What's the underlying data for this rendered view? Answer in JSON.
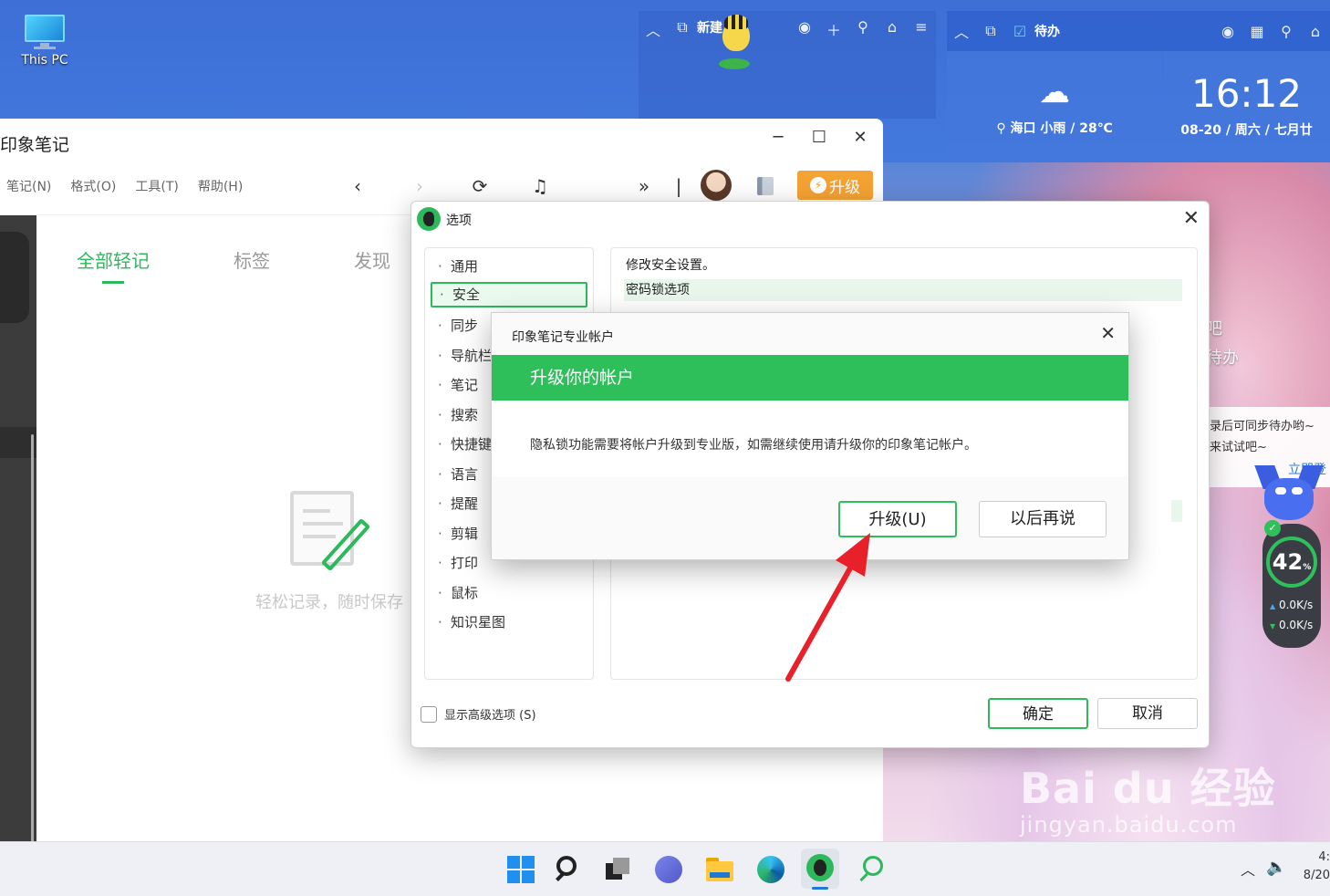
{
  "desktop": {
    "icon_label": "This PC",
    "watermark_brand": "Bai du 经验",
    "watermark_url": "jingyan.baidu.com"
  },
  "widgets": {
    "left_title": "新建",
    "right_title": "待办",
    "weather": "海口 小雨 / 28℃",
    "clock_time": "16:12",
    "clock_date": "08-20 / 周六 / 七月廿",
    "todo_line1": "吧",
    "todo_line2": "待办",
    "sync_line1": "录后可同步待办哟~",
    "sync_line2": "来试试吧~",
    "sync_link": "立即登",
    "speed_percent": "42",
    "speed_unit": "%",
    "speed_up": "0.0K/s",
    "speed_down": "0.0K/s"
  },
  "main_window": {
    "title": "印象笔记",
    "menu": [
      "笔记(N)",
      "格式(O)",
      "工具(T)",
      "帮助(H)"
    ],
    "upgrade_label": "升级",
    "tabs": [
      "全部轻记",
      "标签",
      "发现"
    ],
    "empty_text": "轻松记录，随时保存"
  },
  "options_dialog": {
    "title": "选项",
    "items": [
      "通用",
      "安全",
      "同步",
      "导航栏",
      "笔记",
      "搜索",
      "快捷键",
      "语言",
      "提醒",
      "剪辑",
      "打印",
      "鼠标",
      "知识星图"
    ],
    "selected": "安全",
    "panel_heading": "修改安全设置。",
    "group_label": "密码锁选项",
    "show_advanced": "显示高级选项 (S)",
    "ok_label": "确定",
    "cancel_label": "取消"
  },
  "upgrade_dialog": {
    "title": "印象笔记专业帐户",
    "banner": "升级你的帐户",
    "message": "隐私锁功能需要将帐户升级到专业版，如需继续使用请升级你的印象笔记帐户。",
    "upgrade_button": "升级(U)",
    "later_button": "以后再说"
  },
  "taskbar": {
    "time": "4:",
    "date": "8/20"
  },
  "colors": {
    "evernote_green": "#2db85c",
    "upgrade_orange": "#f5a234",
    "arrow_red": "#e8202a"
  }
}
